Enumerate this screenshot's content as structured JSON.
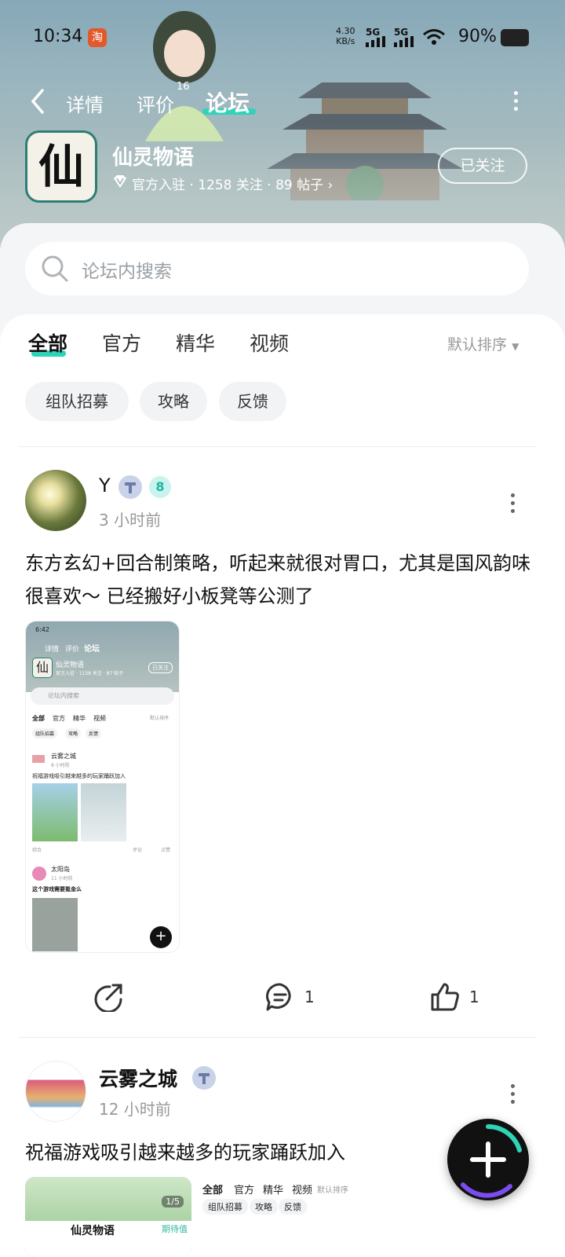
{
  "status_bar": {
    "time": "10:34",
    "app_badge": "淘",
    "net_speed": "4.30",
    "net_unit": "KB/s",
    "sig1": "5G",
    "sig2": "5G",
    "battery": "90%"
  },
  "nav": {
    "tabs": [
      {
        "label": "详情"
      },
      {
        "label": "评价"
      },
      {
        "label": "论坛"
      }
    ],
    "review_count": "16"
  },
  "game": {
    "icon_glyph": "仙",
    "name": "仙灵物语",
    "meta": "官方入驻 · 1258 关注 · 89 帖子",
    "follow_label": "已关注"
  },
  "search": {
    "placeholder": "论坛内搜索"
  },
  "filter": {
    "tabs": [
      "全部",
      "官方",
      "精华",
      "视频"
    ],
    "sort": "默认排序",
    "chips": [
      "组队招募",
      "攻略",
      "反馈"
    ]
  },
  "posts": [
    {
      "user": "Y",
      "time": "3 小时前",
      "level": "8",
      "text": "东方玄幻+回合制策略，听起来就很对胃口，尤其是国风韵味很喜欢～ 已经搬好小板凳等公测了",
      "comments": "1",
      "likes": "1",
      "thumb": {
        "time": "6:42",
        "nav": [
          "详情",
          "评价",
          "论坛"
        ],
        "game_name": "仙灵物语",
        "meta": "官方入驻 · 1158 关注 · 87 帖子",
        "follow": "已关注",
        "search": "论坛内搜索",
        "tabs": [
          "全部",
          "官方",
          "精华",
          "视频"
        ],
        "sort": "默认排序",
        "chips": [
          "组队招募",
          "攻略",
          "反馈"
        ],
        "post_user": "云雾之城",
        "post_time": "8 小时前",
        "post_text": "祝福游戏吸引越来越多的玩家踊跃加入",
        "footer": "综合",
        "comment": "评论",
        "like": "点赞",
        "post2_user": "太阳岛",
        "post2_time": "11 小时前",
        "post2_text": "这个游戏需要氪金么"
      }
    },
    {
      "user": "云雾之城",
      "time": "12 小时前",
      "text": "祝福游戏吸引越来越多的玩家踊跃加入",
      "preview": {
        "page": "1/5",
        "game_name": "仙灵物语",
        "tag": "期待值",
        "tabs": [
          "全部",
          "官方",
          "精华",
          "视频"
        ],
        "sort": "默认排序",
        "chips": [
          "组队招募",
          "攻略",
          "反馈"
        ]
      }
    }
  ]
}
